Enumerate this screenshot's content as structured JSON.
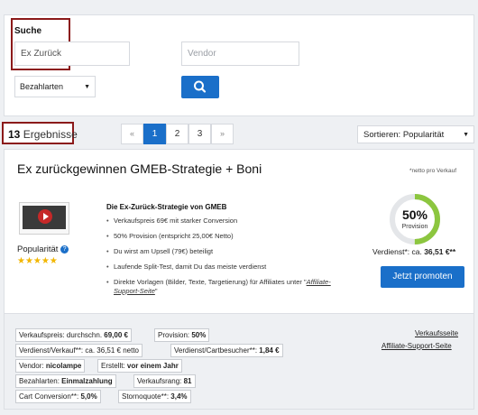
{
  "search": {
    "title": "Suche",
    "keyword_value": "Ex Zurück",
    "vendor_placeholder": "Vendor",
    "payment_select": "Bezahlarten"
  },
  "results": {
    "count": "13",
    "label": "Ergebnisse",
    "pages": [
      "«",
      "1",
      "2",
      "3",
      "»"
    ],
    "active_page": "1",
    "sort": "Sortieren: Popularität"
  },
  "product": {
    "title": "Ex zurückgewinnen GMEB-Strategie + Boni",
    "netto_note": "*netto pro Verkauf",
    "popularity_label": "Popularität",
    "stars": "★★★★★",
    "description_title": "Die Ex-Zurück-Strategie von GMEB",
    "bullets": [
      "Verkaufspreis 69€ mit starker Conversion",
      "50% Provision (entspricht 25,00€ Netto)",
      "Du wirst am Upsell (79€) beteiligt",
      "Laufende Split-Test, damit Du das meiste verdienst",
      "Direkte Vorlagen (Bilder, Texte, Targetierung) für Affiliates unter \""
    ],
    "bullet_link": "Affiliate-Support-Seite",
    "bullet_link_suffix": "\"",
    "commission_percent": "50%",
    "commission_fraction": 0.5,
    "commission_label": "Provision",
    "earned_label": "Verdienst*: ca.",
    "earned_value": "36,51 €**",
    "promote_button": "Jetzt promoten"
  },
  "stats": {
    "row1": [
      {
        "label": "Verkaufspreis: durchschn.",
        "value": "69,00 €"
      },
      {
        "label": "Provision:",
        "value": "50%"
      }
    ],
    "row2": [
      {
        "label": "Verdienst/Verkauf**: ca.",
        "value": "36,51 € netto",
        "value_bold": false
      },
      {
        "label": "Verdienst/Cartbesucher**:",
        "value": "1,84 €"
      }
    ],
    "row3": [
      {
        "label": "Vendor:",
        "value": "nicolampe"
      },
      {
        "label": "Erstellt:",
        "value": "vor einem Jahr"
      }
    ],
    "row4": [
      {
        "label": "Bezahlarten:",
        "value": "Einmalzahlung"
      },
      {
        "label": "Verkaufsrang:",
        "value": "81"
      }
    ],
    "row5": [
      {
        "label": "Cart Conversion**:",
        "value": "5,0%"
      },
      {
        "label": "Stornoquote**:",
        "value": "3,4%"
      }
    ],
    "links": [
      "Verkaufsseite",
      "Affiliate-Support-Seite"
    ]
  },
  "colors": {
    "accent": "#1a6fc9",
    "highlight_border": "#8b1a1a",
    "ring_green": "#8cc63f",
    "stars": "#f2b600"
  }
}
